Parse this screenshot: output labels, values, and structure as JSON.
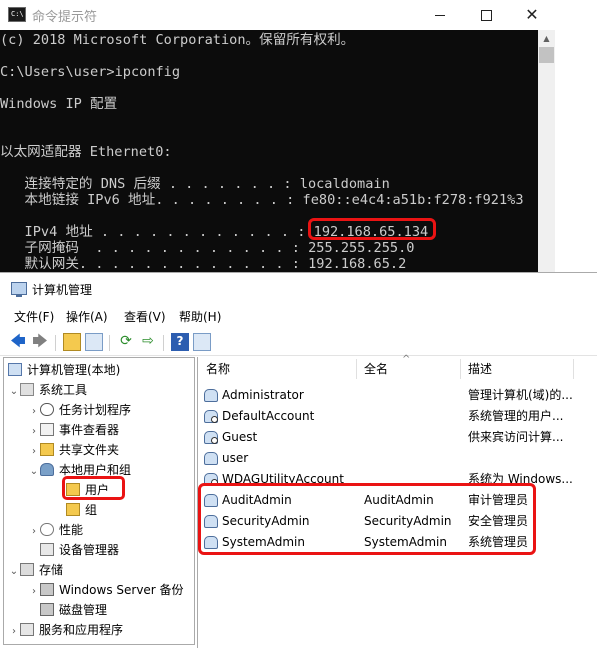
{
  "cmd": {
    "title": "命令提示符",
    "icon_label": "C:\\",
    "minimize_glyph": "",
    "close_glyph": "✕",
    "lines": [
      "(c) 2018 Microsoft Corporation。保留所有权利。",
      "",
      "C:\\Users\\user>ipconfig",
      "",
      "Windows IP 配置",
      "",
      "",
      "以太网适配器 Ethernet0:",
      "",
      "   连接特定的 DNS 后缀 . . . . . . . : localdomain",
      "   本地链接 IPv6 地址. . . . . . . . : fe80::e4c4:a51b:f278:f921%3",
      "   IPv4 地址 . . . . . . . . . . . . : 192.168.65.134",
      "   子网掩码  . . . . . . . . . . . . : 255.255.255.0",
      "   默认网关. . . . . . . . . . . . . : 192.168.65.2"
    ]
  },
  "mmc": {
    "title": "计算机管理",
    "menus": [
      "文件(F)",
      "操作(A)",
      "查看(V)",
      "帮助(H)"
    ],
    "toolbar": {
      "back": "🡄",
      "forward": "🡆",
      "refresh": "⟳",
      "export": "⇨",
      "help": "?"
    },
    "tree": [
      {
        "label": "计算机管理(本地)",
        "arrow": "",
        "icon": "computer-icon"
      },
      {
        "label": "系统工具",
        "arrow": "⌄",
        "icon": "tools-icon"
      },
      {
        "label": "任务计划程序",
        "arrow": "›",
        "icon": "clock-icon"
      },
      {
        "label": "事件查看器",
        "arrow": "›",
        "icon": "event-viewer-icon"
      },
      {
        "label": "共享文件夹",
        "arrow": "›",
        "icon": "shared-folder-icon"
      },
      {
        "label": "本地用户和组",
        "arrow": "⌄",
        "icon": "users-icon"
      },
      {
        "label": "用户",
        "arrow": "",
        "icon": "folder-icon"
      },
      {
        "label": "组",
        "arrow": "",
        "icon": "folder-icon"
      },
      {
        "label": "性能",
        "arrow": "›",
        "icon": "performance-icon"
      },
      {
        "label": "设备管理器",
        "arrow": "",
        "icon": "device-manager-icon"
      },
      {
        "label": "存储",
        "arrow": "⌄",
        "icon": "storage-icon"
      },
      {
        "label": "Windows Server 备份",
        "arrow": "›",
        "icon": "backup-icon"
      },
      {
        "label": "磁盘管理",
        "arrow": "",
        "icon": "disk-icon"
      },
      {
        "label": "服务和应用程序",
        "arrow": "›",
        "icon": "services-icon"
      }
    ],
    "columns": [
      "名称",
      "全名",
      "描述"
    ],
    "sort_glyph": "^",
    "users": [
      {
        "name": "Administrator",
        "full_name": "",
        "description": "管理计算机(域)的..."
      },
      {
        "name": "DefaultAccount",
        "full_name": "",
        "description": "系统管理的用户..."
      },
      {
        "name": "Guest",
        "full_name": "",
        "description": "供来宾访问计算..."
      },
      {
        "name": "user",
        "full_name": "",
        "description": ""
      },
      {
        "name": "WDAGUtilityAccount",
        "full_name": "",
        "description": "系统为 Windows..."
      },
      {
        "name": "AuditAdmin",
        "full_name": "AuditAdmin",
        "description": "审计管理员"
      },
      {
        "name": "SecurityAdmin",
        "full_name": "SecurityAdmin",
        "description": "安全管理员"
      },
      {
        "name": "SystemAdmin",
        "full_name": "SystemAdmin",
        "description": "系统管理员"
      }
    ]
  },
  "highlight_color": "#ea1313"
}
